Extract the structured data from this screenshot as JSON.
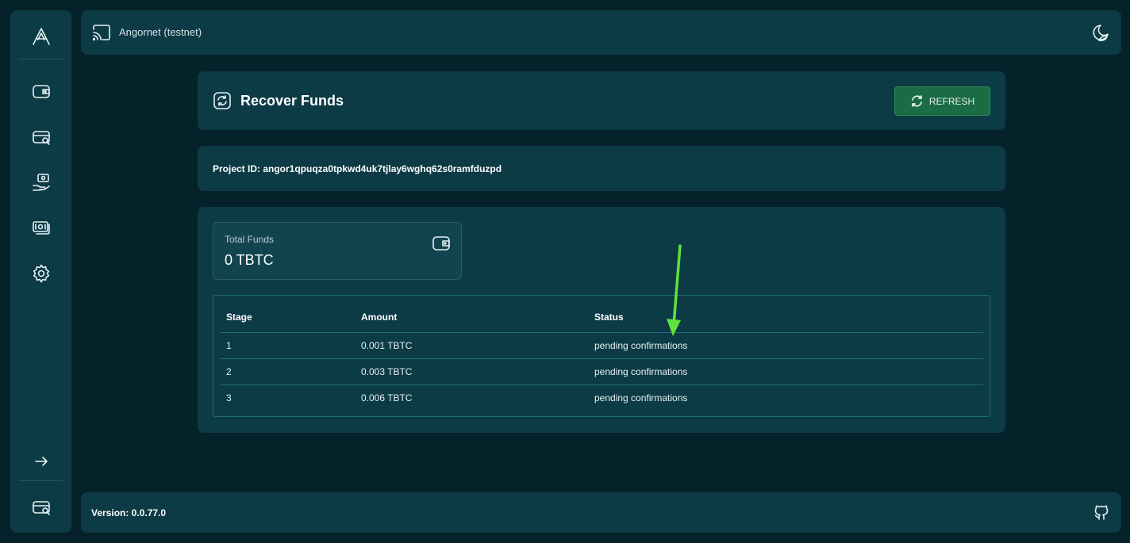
{
  "header": {
    "network_name": "Angornet (testnet)"
  },
  "sidebar": {
    "items": [
      {
        "icon": "logo-icon"
      },
      {
        "icon": "wallet-icon"
      },
      {
        "icon": "browse-projects-icon"
      },
      {
        "icon": "invest-icon"
      },
      {
        "icon": "money-icon"
      },
      {
        "icon": "gear-icon"
      },
      {
        "icon": "arrow-right-icon"
      },
      {
        "icon": "browse-projects-icon"
      }
    ]
  },
  "page": {
    "title": "Recover Funds",
    "refresh_label": "REFRESH",
    "project_id": "Project ID: angor1qpuqza0tpkwd4uk7tjlay6wghq62s0ramfduzpd",
    "total_funds_label": "Total Funds",
    "total_funds_value": "0 TBTC"
  },
  "table": {
    "headers": [
      "Stage",
      "Amount",
      "Status"
    ],
    "rows": [
      {
        "stage": "1",
        "amount": "0.001 TBTC",
        "status": "pending confirmations"
      },
      {
        "stage": "2",
        "amount": "0.003 TBTC",
        "status": "pending confirmations"
      },
      {
        "stage": "3",
        "amount": "0.006 TBTC",
        "status": "pending confirmations"
      }
    ]
  },
  "footer": {
    "version": "Version: 0.0.77.0"
  },
  "colors": {
    "background": "#05222a",
    "panel": "#0c3a45",
    "accent_button": "#1b6b45",
    "annotation_arrow": "#5de33a"
  }
}
